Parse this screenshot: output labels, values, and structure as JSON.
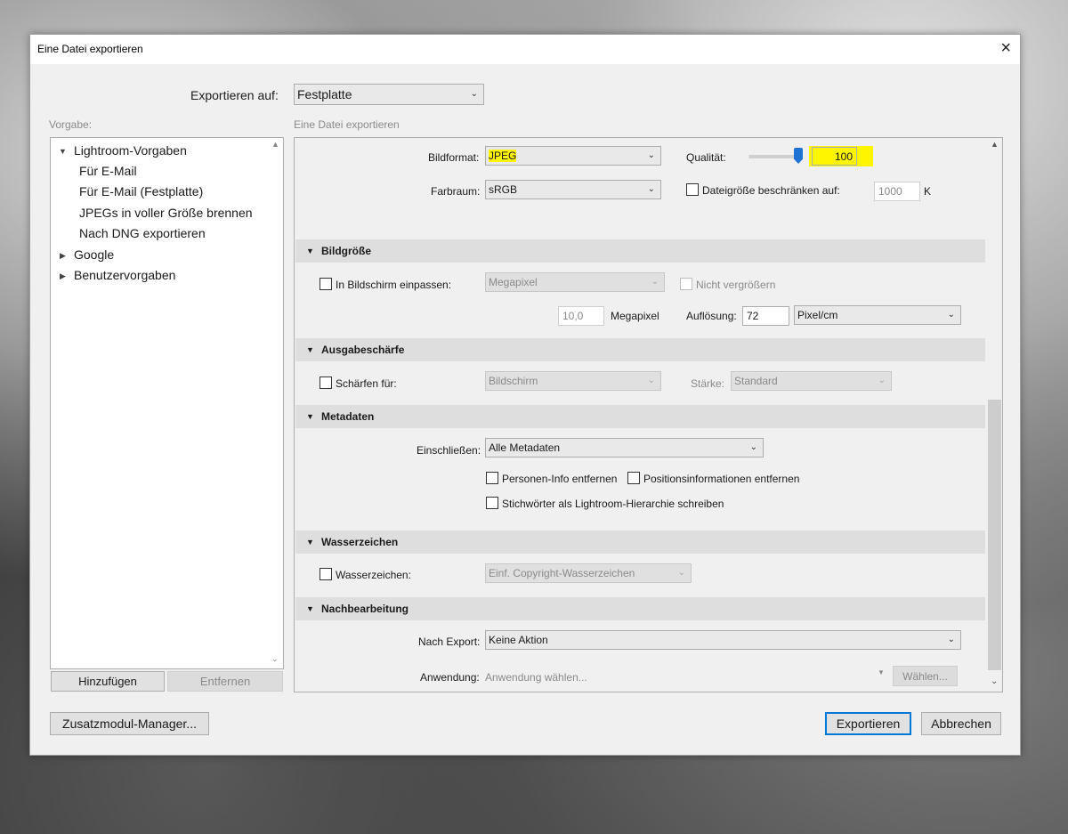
{
  "dialog": {
    "title": "Eine Datei exportieren",
    "close_glyph": "×",
    "export_to_label": "Exportieren auf:",
    "export_to_value": "Festplatte",
    "preset_label": "Vorgabe:",
    "right_header": "Eine Datei exportieren"
  },
  "presets": {
    "groups": [
      {
        "name": "Lightroom-Vorgaben",
        "expanded": true,
        "items": [
          "Für E-Mail",
          "Für E-Mail (Festplatte)",
          "JPEGs in voller Größe brennen",
          "Nach DNG exportieren"
        ]
      },
      {
        "name": "Google",
        "expanded": false
      },
      {
        "name": "Benutzervorgaben",
        "expanded": false
      }
    ],
    "add_button": "Hinzufügen",
    "remove_button": "Entfernen"
  },
  "file_settings": {
    "format_label": "Bildformat:",
    "format_value": "JPEG",
    "quality_label": "Qualität:",
    "quality_value": "100",
    "quality_fraction": 1.0,
    "colorspace_label": "Farbraum:",
    "colorspace_value": "sRGB",
    "limit_size_label": "Dateigröße beschränken auf:",
    "limit_size_value": "1000",
    "limit_size_unit": "K"
  },
  "image_size": {
    "title": "Bildgröße",
    "fit_label": "In Bildschirm einpassen:",
    "fit_value": "Megapixel",
    "no_enlarge_label": "Nicht vergrößern",
    "megapixel_value": "10,0",
    "megapixel_unit": "Megapixel",
    "resolution_label": "Auflösung:",
    "resolution_value": "72",
    "resolution_unit": "Pixel/cm"
  },
  "sharpening": {
    "title": "Ausgabeschärfe",
    "sharpen_label": "Schärfen für:",
    "sharpen_value": "Bildschirm",
    "amount_label": "Stärke:",
    "amount_value": "Standard"
  },
  "metadata": {
    "title": "Metadaten",
    "include_label": "Einschließen:",
    "include_value": "Alle Metadaten",
    "remove_person_label": "Personen-Info entfernen",
    "remove_location_label": "Positionsinformationen entfernen",
    "keywords_label": "Stichwörter als Lightroom-Hierarchie schreiben"
  },
  "watermark": {
    "title": "Wasserzeichen",
    "label": "Wasserzeichen:",
    "value": "Einf. Copyright-Wasserzeichen"
  },
  "post_processing": {
    "title": "Nachbearbeitung",
    "after_export_label": "Nach Export:",
    "after_export_value": "Keine Aktion",
    "application_label": "Anwendung:",
    "application_placeholder": "Anwendung wählen...",
    "choose_button": "Wählen..."
  },
  "footer": {
    "plugin_manager": "Zusatzmodul-Manager...",
    "export": "Exportieren",
    "cancel": "Abbrechen"
  },
  "colors": {
    "highlight": "#fff500",
    "accent": "#0078d7"
  }
}
